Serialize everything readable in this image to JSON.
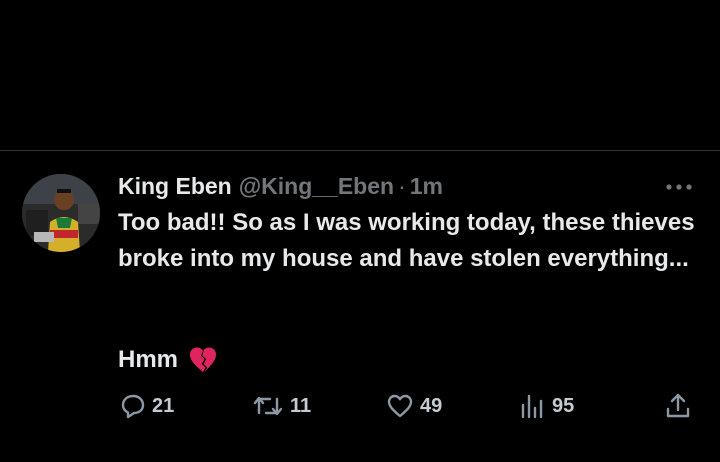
{
  "tweet": {
    "display_name": "King Eben",
    "handle": "@King__Eben",
    "separator": "·",
    "time": "1m",
    "text": "Too bad!! So as I was working today, these thieves broke into my house and have stolen everything...",
    "text_line2": "Hmm",
    "emoji": "broken-heart-icon"
  },
  "actions": {
    "replies": "21",
    "retweets": "11",
    "likes": "49",
    "views": "95"
  },
  "colors": {
    "background": "#000000",
    "text": "#e7e9ea",
    "secondary": "#71767b",
    "heart_red": "#e0245e"
  }
}
